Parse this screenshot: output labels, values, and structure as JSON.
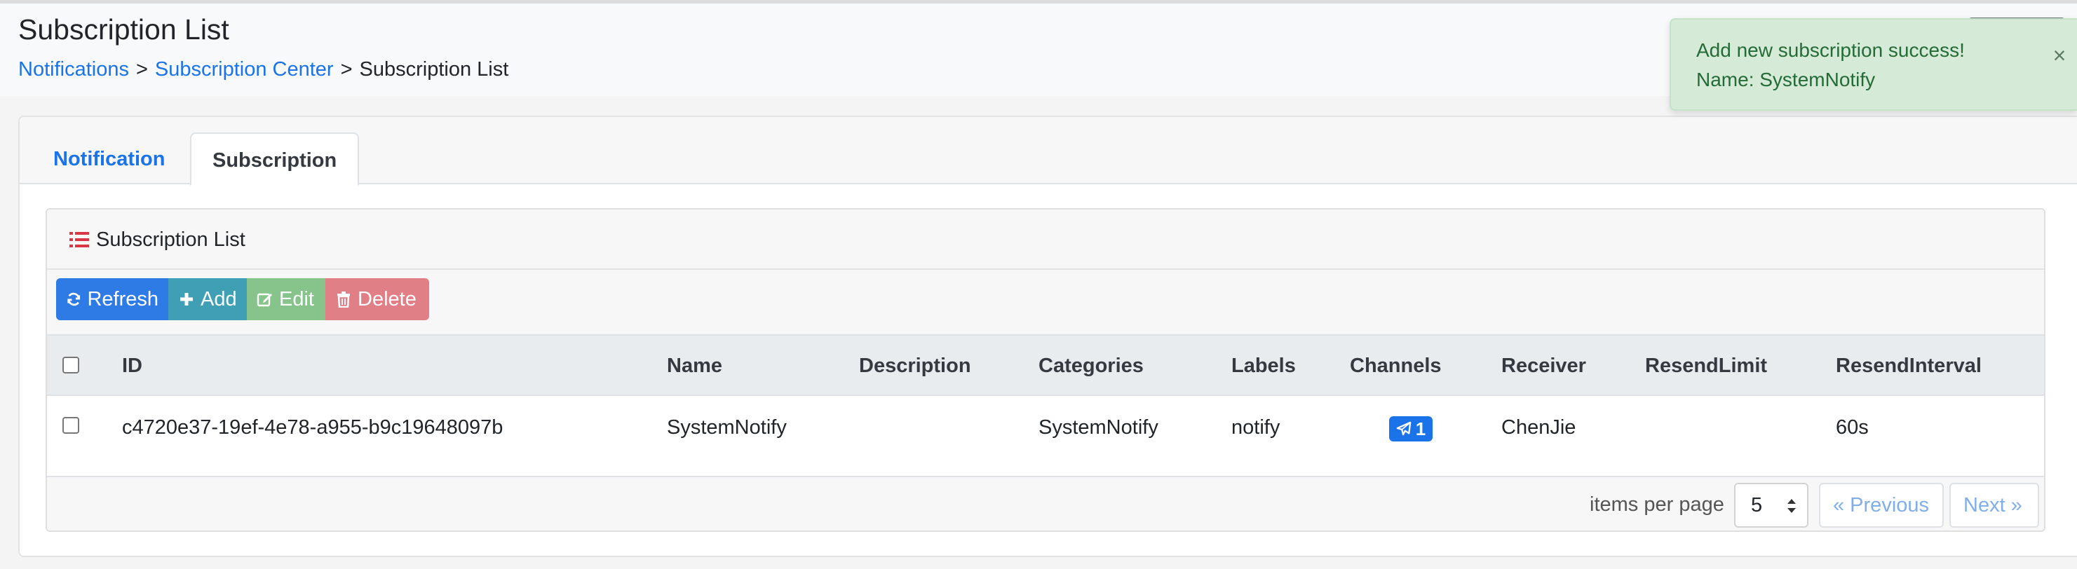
{
  "header": {
    "title": "Subscription List",
    "breadcrumb": [
      "Notifications",
      "Subscription Center",
      "Subscription List"
    ],
    "separator": ">"
  },
  "tabs": [
    {
      "label": "Notification",
      "active": false
    },
    {
      "label": "Subscription",
      "active": true
    }
  ],
  "panel": {
    "title": "Subscription List",
    "title_icon": "list-icon",
    "buttons": {
      "refresh": "Refresh",
      "add": "Add",
      "edit": "Edit",
      "delete": "Delete"
    }
  },
  "table": {
    "columns": [
      "ID",
      "Name",
      "Description",
      "Categories",
      "Labels",
      "Channels",
      "Receiver",
      "ResendLimit",
      "ResendInterval"
    ],
    "rows": [
      {
        "id": "c4720e37-19ef-4e78-a955-b9c19648097b",
        "name": "SystemNotify",
        "description": "",
        "categories": "SystemNotify",
        "labels": "notify",
        "channels_count": "1",
        "channels_icon": "paper-plane-icon",
        "receiver": "ChenJie",
        "resend_limit": "",
        "resend_interval": "60s"
      }
    ]
  },
  "pagination": {
    "items_per_page_label": "items per page",
    "items_per_page": "5",
    "previous": "« Previous",
    "next": "Next »"
  },
  "toast": {
    "line1": "Add new subscription success!",
    "line2": "Name: SystemNotify",
    "close": "×"
  },
  "colors": {
    "primary": "#2f7be5",
    "info": "#3fa0b5",
    "success": "#86c48c",
    "danger": "#e07f86",
    "link": "#1a73e8",
    "toast_bg": "#d5ebd8",
    "toast_text": "#256b37"
  }
}
